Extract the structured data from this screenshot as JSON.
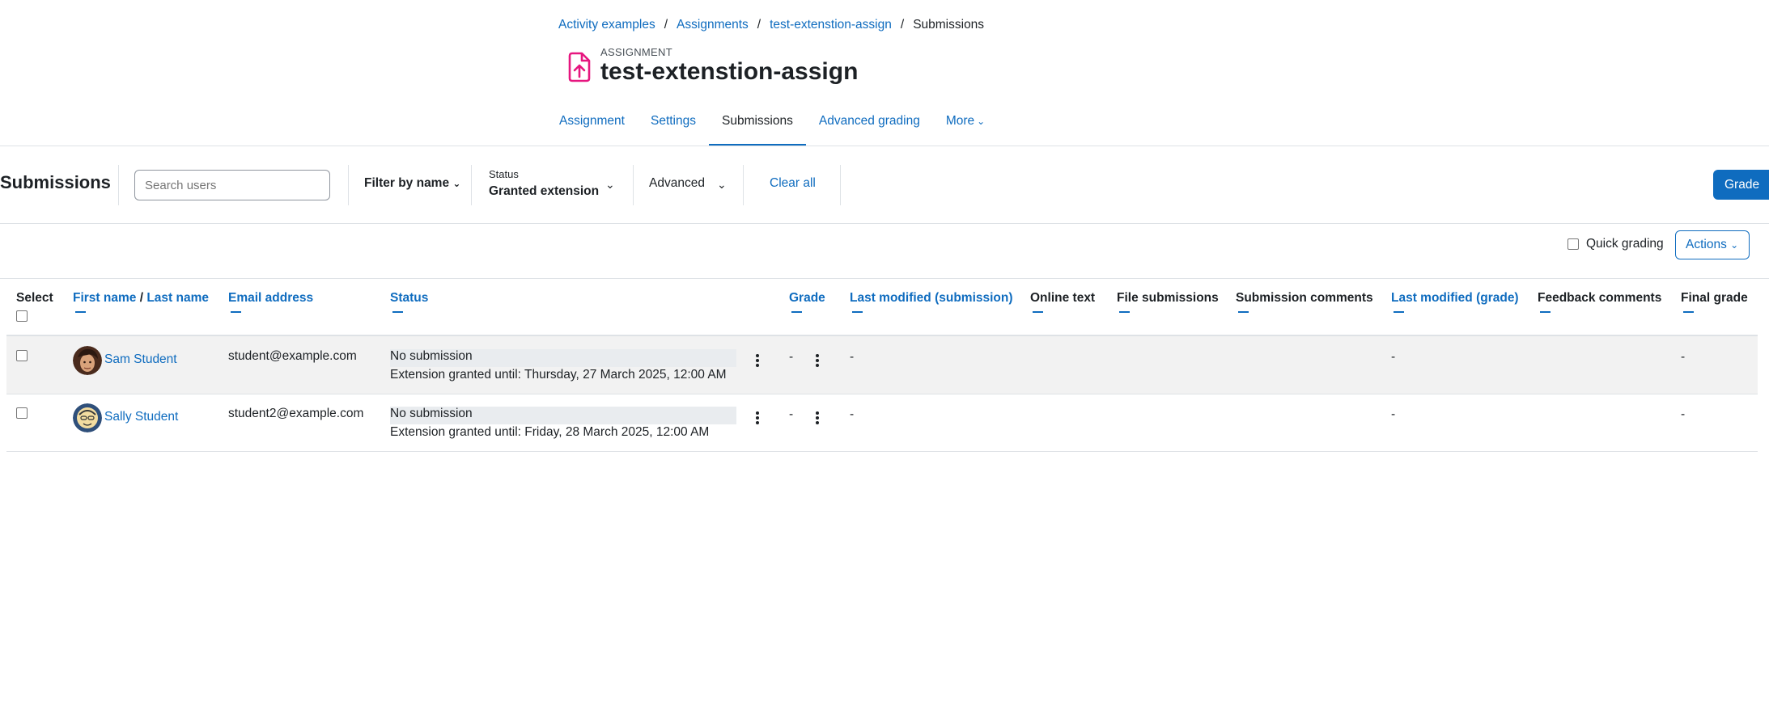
{
  "breadcrumb": [
    "Activity examples",
    "Assignments",
    "test-extenstion-assign",
    "Submissions"
  ],
  "header": {
    "type_label": "ASSIGNMENT",
    "title": "test-extenstion-assign"
  },
  "tabs": [
    {
      "label": "Assignment"
    },
    {
      "label": "Settings"
    },
    {
      "label": "Submissions",
      "active": true
    },
    {
      "label": "Advanced grading"
    },
    {
      "label": "More"
    }
  ],
  "filters": {
    "heading": "Submissions",
    "search_placeholder": "Search users",
    "filter_by_name": "Filter by name",
    "status_label": "Status",
    "status_value": "Granted extension",
    "advanced": "Advanced",
    "clear_all": "Clear all",
    "grade_button": "Grade"
  },
  "toolbar": {
    "quick_grading": "Quick grading",
    "actions": "Actions"
  },
  "table": {
    "headers": {
      "select": "Select",
      "first_name": "First name",
      "slash": "/",
      "last_name": "Last name",
      "email": "Email address",
      "status": "Status",
      "grade": "Grade",
      "last_modified_submission": "Last modified (submission)",
      "online_text": "Online text",
      "file_submissions": "File submissions",
      "submission_comments": "Submission comments",
      "last_modified_grade": "Last modified (grade)",
      "feedback_comments": "Feedback comments",
      "final_grade": "Final grade"
    },
    "rows": [
      {
        "name": "Sam Student",
        "email": "student@example.com",
        "status": "No submission",
        "extension": "Extension granted until: Thursday, 27 March 2025, 12:00 AM",
        "grade": "-",
        "last_modified_submission": "-",
        "last_modified_grade": "-",
        "final_grade": "-"
      },
      {
        "name": "Sally Student",
        "email": "student2@example.com",
        "status": "No submission",
        "extension": "Extension granted until: Friday, 28 March 2025, 12:00 AM",
        "grade": "-",
        "last_modified_submission": "-",
        "last_modified_grade": "-",
        "final_grade": "-"
      }
    ]
  },
  "colors": {
    "link": "#0f6cbf",
    "icon_accent": "#e6167f",
    "row_highlight": "#f2f2f2"
  },
  "icons": {
    "assignment": "file-upload-icon",
    "chevron": "chevron-down-icon",
    "kebab": "more-vertical-icon"
  }
}
